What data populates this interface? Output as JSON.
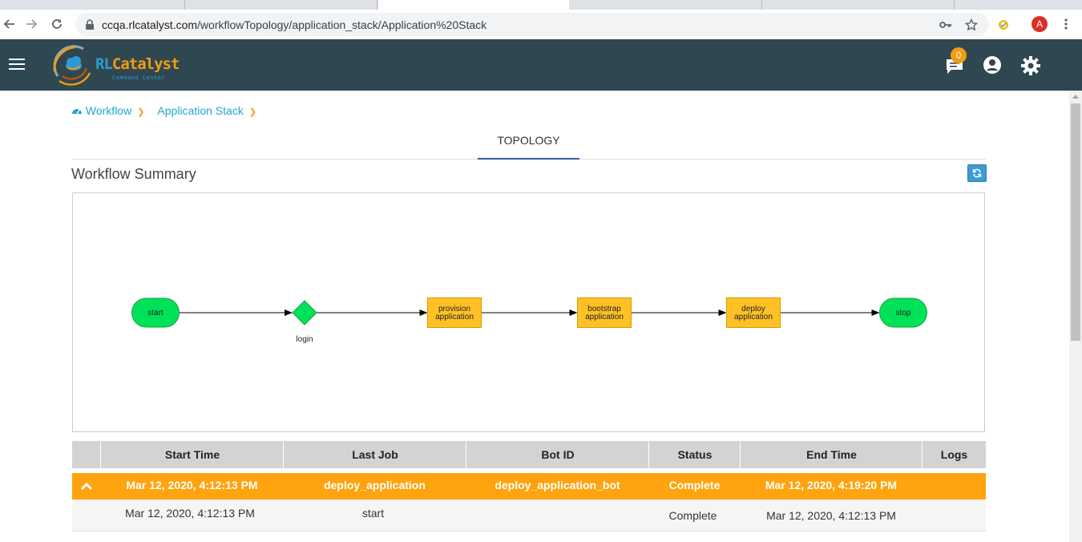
{
  "browser": {
    "url_host": "ccqa.rlcatalyst.com",
    "url_path": "/workflowTopology/application_stack/Application%20Stack",
    "profile_initial": "A"
  },
  "header": {
    "logo_main": "RL",
    "logo_accent": "Catalyst",
    "logo_sub": "Command Center",
    "notification_count": "0"
  },
  "breadcrumb": {
    "items": [
      "Workflow",
      "Application Stack"
    ]
  },
  "tabs": {
    "active": "TOPOLOGY"
  },
  "summary": {
    "title": "Workflow Summary"
  },
  "diagram": {
    "nodes": [
      {
        "id": "start",
        "label": "start",
        "shape": "terminal",
        "color": "#00e15a"
      },
      {
        "id": "login",
        "label": "login",
        "shape": "decision",
        "color": "#00e15a"
      },
      {
        "id": "provision",
        "label": "provision application",
        "shape": "task",
        "color": "#ffc125"
      },
      {
        "id": "bootstrap",
        "label": "bootstrap application",
        "shape": "task",
        "color": "#ffc125"
      },
      {
        "id": "deploy",
        "label": "deploy application",
        "shape": "task",
        "color": "#ffc125"
      },
      {
        "id": "stop",
        "label": "stop",
        "shape": "terminal",
        "color": "#00e15a"
      }
    ],
    "edges": [
      [
        "start",
        "login"
      ],
      [
        "login",
        "provision"
      ],
      [
        "provision",
        "bootstrap"
      ],
      [
        "bootstrap",
        "deploy"
      ],
      [
        "deploy",
        "stop"
      ]
    ]
  },
  "table": {
    "columns": [
      "Start Time",
      "Last Job",
      "Bot ID",
      "Status",
      "End Time",
      "Logs"
    ],
    "main_row": {
      "start_time": "Mar 12, 2020, 4:12:13 PM",
      "last_job": "deploy_application",
      "bot_id": "deploy_application_bot",
      "status": "Complete",
      "end_time": "Mar 12, 2020, 4:19:20 PM"
    },
    "sub_row": {
      "start_time": "Mar 12, 2020, 4:12:13 PM",
      "last_job": "start",
      "status": "Complete",
      "end_time": "Mar 12, 2020, 4:12:13 PM"
    }
  },
  "colors": {
    "appbar": "#2f4750",
    "accent_orange": "#ffa30e",
    "link_blue": "#21a4d6",
    "node_green": "#00e15a",
    "node_yellow": "#ffc125"
  }
}
